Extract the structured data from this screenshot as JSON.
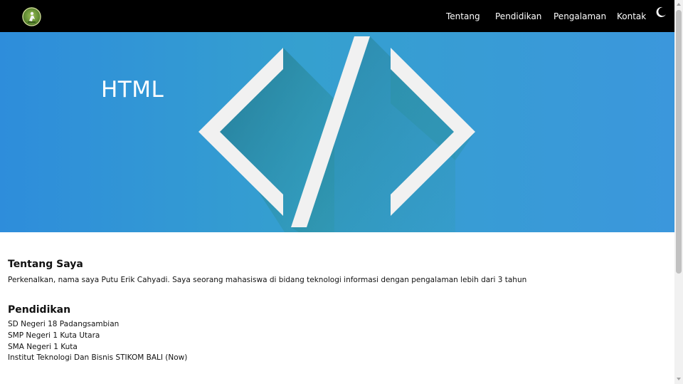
{
  "nav": {
    "items": [
      {
        "label": "Tentang"
      },
      {
        "label": "Pendidikan"
      },
      {
        "label": "Pengalaman"
      },
      {
        "label": "Kontak"
      }
    ],
    "theme_icon": "moon-icon"
  },
  "hero": {
    "title": "HTML",
    "icon": "code-brackets-icon"
  },
  "about": {
    "heading": "Tentang Saya",
    "text": "Perkenalkan, nama saya Putu Erik Cahyadi. Saya seorang mahasiswa di bidang teknologi informasi dengan pengalaman lebih dari 3 tahun"
  },
  "education": {
    "heading": "Pendidikan",
    "items": [
      "SD Negeri 18 Padangsambian",
      "SMP Negeri 1 Kuta Utara",
      "SMA Negeri 1 Kuta",
      "Institut Teknologi Dan Bisnis STIKOM BALI (Now)"
    ]
  },
  "colors": {
    "navbar": "#000000",
    "hero_gradient_start": "#2f8fd6",
    "hero_gradient_end": "#3fa3d8",
    "hero_accent": "#2a8a8a"
  }
}
